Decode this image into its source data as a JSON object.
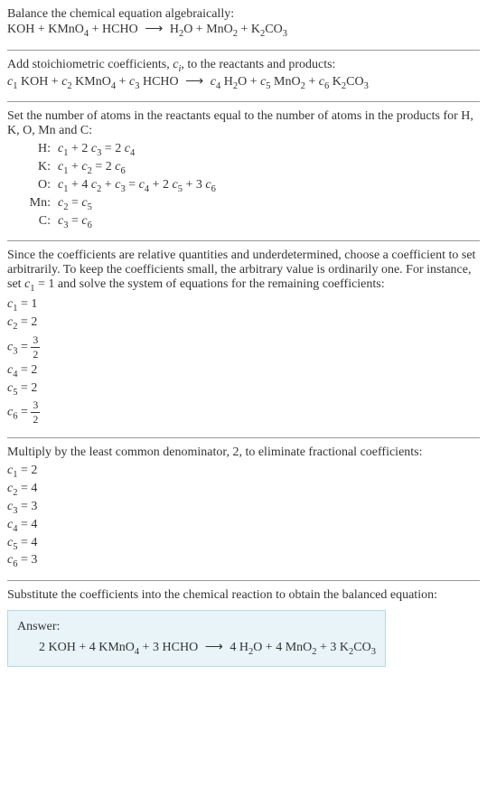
{
  "intro": {
    "line1": "Balance the chemical equation algebraically:",
    "eq": "KOH + KMnO₄ + HCHO ⟶ H₂O + MnO₂ + K₂CO₃"
  },
  "stoich": {
    "text": "Add stoichiometric coefficients, cᵢ, to the reactants and products:",
    "eq": "c₁ KOH + c₂ KMnO₄ + c₃ HCHO ⟶ c₄ H₂O + c₅ MnO₂ + c₆ K₂CO₃"
  },
  "atoms": {
    "text": "Set the number of atoms in the reactants equal to the number of atoms in the products for H, K, O, Mn and C:",
    "rows": [
      {
        "el": "H:",
        "eq": "c₁ + 2 c₃ = 2 c₄"
      },
      {
        "el": "K:",
        "eq": "c₁ + c₂ = 2 c₆"
      },
      {
        "el": "O:",
        "eq": "c₁ + 4 c₂ + c₃ = c₄ + 2 c₅ + 3 c₆"
      },
      {
        "el": "Mn:",
        "eq": "c₂ = c₅"
      },
      {
        "el": "C:",
        "eq": "c₃ = c₆"
      }
    ]
  },
  "choose": {
    "text": "Since the coefficients are relative quantities and underdetermined, choose a coefficient to set arbitrarily. To keep the coefficients small, the arbitrary value is ordinarily one. For instance, set c₁ = 1 and solve the system of equations for the remaining coefficients:",
    "coefs": [
      {
        "lhs": "c₁ = ",
        "rhs": "1",
        "frac": false
      },
      {
        "lhs": "c₂ = ",
        "rhs": "2",
        "frac": false
      },
      {
        "lhs": "c₃ = ",
        "rhs": "3/2",
        "frac": true,
        "num": "3",
        "den": "2"
      },
      {
        "lhs": "c₄ = ",
        "rhs": "2",
        "frac": false
      },
      {
        "lhs": "c₅ = ",
        "rhs": "2",
        "frac": false
      },
      {
        "lhs": "c₆ = ",
        "rhs": "3/2",
        "frac": true,
        "num": "3",
        "den": "2"
      }
    ]
  },
  "multiply": {
    "text": "Multiply by the least common denominator, 2, to eliminate fractional coefficients:",
    "coefs": [
      "c₁ = 2",
      "c₂ = 4",
      "c₃ = 3",
      "c₄ = 4",
      "c₅ = 4",
      "c₆ = 3"
    ]
  },
  "substitute": {
    "text": "Substitute the coefficients into the chemical reaction to obtain the balanced equation:"
  },
  "answer": {
    "label": "Answer:",
    "eq": "2 KOH + 4 KMnO₄ + 3 HCHO ⟶ 4 H₂O + 4 MnO₂ + 3 K₂CO₃"
  }
}
